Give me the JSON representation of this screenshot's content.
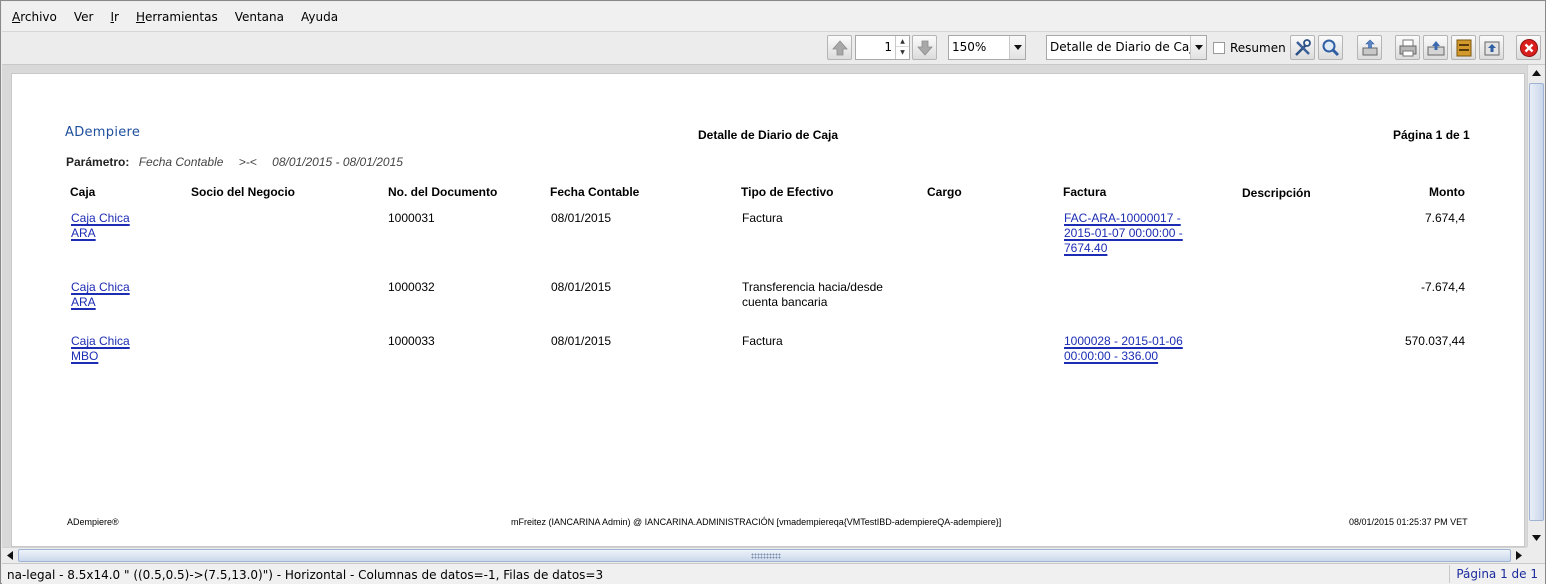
{
  "menu": [
    {
      "pre": "",
      "mn": "A",
      "post": "rchivo"
    },
    {
      "pre": "",
      "mn": "",
      "post": "Ver"
    },
    {
      "pre": "",
      "mn": "I",
      "post": "r"
    },
    {
      "pre": "",
      "mn": "H",
      "post": "erramientas"
    },
    {
      "pre": "",
      "mn": "",
      "post": "Ventana"
    },
    {
      "pre": "",
      "mn": "",
      "post": "Ayuda"
    }
  ],
  "toolbar": {
    "page_number": "1",
    "zoom": "150%",
    "report_select": "Detalle de Diario de Caja",
    "summary_label": "Resumen",
    "icons": [
      "arrow-up-icon",
      "arrow-down-icon",
      "customize-icon",
      "find-icon",
      "export-icon",
      "print-icon",
      "archive-icon",
      "send-icon",
      "print-format-icon",
      "close-icon"
    ]
  },
  "report": {
    "logo": "ADempiere",
    "title": "Detalle de Diario de Caja",
    "page_info": "Página 1 de 1",
    "param_label": "Parámetro:",
    "param_name": "Fecha Contable",
    "param_op": ">-<",
    "param_value": "08/01/2015 - 08/01/2015",
    "columns": {
      "caja": "Caja",
      "socio": "Socio del Negocio",
      "doc": "No. del Documento",
      "fecha": "Fecha Contable",
      "tipo": "Tipo de Efectivo",
      "cargo": "Cargo",
      "factura": "Factura",
      "descripcion": "Descripción",
      "monto": "Monto"
    },
    "rows": [
      {
        "caja1": "Caja Chica",
        "caja2": "ARA",
        "doc": "1000031",
        "fecha": "08/01/2015",
        "tipo1": "Factura",
        "tipo2": "",
        "fact1": "FAC-ARA-10000017 -",
        "fact2": "2015-01-07 00:00:00 -",
        "fact3": "7674.40",
        "monto": "7.674,4"
      },
      {
        "caja1": "Caja Chica",
        "caja2": "ARA",
        "doc": "1000032",
        "fecha": "08/01/2015",
        "tipo1": "Transferencia hacia/desde",
        "tipo2": "cuenta bancaria",
        "fact1": "",
        "fact2": "",
        "fact3": "",
        "monto": "-7.674,4"
      },
      {
        "caja1": "Caja Chica",
        "caja2": "MBO",
        "doc": "1000033",
        "fecha": "08/01/2015",
        "tipo1": "Factura",
        "tipo2": "",
        "fact1": "1000028 - 2015-01-06",
        "fact2": "00:00:00 - 336.00",
        "fact3": "",
        "monto": "570.037,44"
      }
    ],
    "footer_left": "ADempiere®",
    "footer_center": "mFreitez (IANCARINA Admin) @ IANCARINA.ADMINISTRACIÓN [vmadempiereqa{VMTestIBD-adempiereQA-adempiere}]",
    "footer_right": "08/01/2015 01:25:37 PM VET"
  },
  "status": {
    "text": "na-legal - 8.5x14.0 \" ((0.5,0.5)->(7.5,13.0)\") - Horizontal - Columnas de datos=-1, Filas de datos=3",
    "page": "Página 1 de 1"
  }
}
